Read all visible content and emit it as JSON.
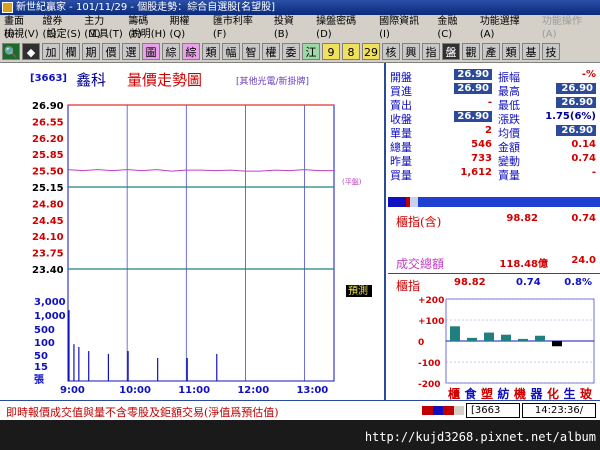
{
  "window": {
    "title": "新世紀贏家 - 101/11/29 - 個股走勢：綜合自選股[名望股]"
  },
  "menu": {
    "row1": [
      "畫面(I)",
      "證券(E)",
      "主力(M)",
      "籌碼(F)",
      "期權(Q)",
      "匯市利率(F)",
      "投資(B)",
      "操盤密碼(D)",
      "國際資訊(I)",
      "金融(C)",
      "功能選擇(A)",
      "功能操作(A)"
    ],
    "row1_disabled": [
      false,
      false,
      false,
      false,
      false,
      false,
      false,
      false,
      false,
      false,
      false,
      true
    ],
    "row2": [
      "檢視(V)",
      "設定(S)",
      "工具(T)",
      "說明(H)"
    ]
  },
  "toolbar": {
    "buttons": [
      {
        "label": "🔍",
        "icon": "search-icon",
        "style": "search"
      },
      {
        "label": "◆",
        "icon": "diamond-icon",
        "style": "dark"
      },
      {
        "label": "加",
        "style": "plain"
      },
      {
        "label": "欄",
        "style": "plain"
      },
      {
        "label": "期",
        "style": "plain"
      },
      {
        "label": "價",
        "style": "plain"
      },
      {
        "label": "選",
        "style": "plain"
      },
      {
        "label": "圖",
        "style": "magenta"
      },
      {
        "label": "綜",
        "style": "plain"
      },
      {
        "label": "綜",
        "style": "magenta"
      },
      {
        "label": "類",
        "style": "plain"
      },
      {
        "label": "幅",
        "style": "plain"
      },
      {
        "label": "智",
        "style": "plain"
      },
      {
        "label": "權",
        "style": "plain"
      },
      {
        "label": "委",
        "style": "plain"
      },
      {
        "label": "江",
        "style": "green"
      },
      {
        "label": "9",
        "style": "yellow"
      },
      {
        "label": "8",
        "style": "yellow"
      },
      {
        "label": "29",
        "style": "yellow"
      },
      {
        "label": "核",
        "style": "plain"
      },
      {
        "label": "興",
        "style": "plain"
      },
      {
        "label": "指",
        "style": "plain"
      },
      {
        "label": "盤",
        "style": "dark"
      },
      {
        "label": "觀",
        "style": "plain"
      },
      {
        "label": "產",
        "style": "plain"
      },
      {
        "label": "類",
        "style": "plain"
      },
      {
        "label": "基",
        "style": "plain"
      },
      {
        "label": "技",
        "style": "plain"
      }
    ]
  },
  "chart_header": {
    "code": "[3663]",
    "name": "鑫科",
    "title": "量價走勢圖",
    "sector": "[其他光電/新掛牌]"
  },
  "chart_data": {
    "type": "line",
    "price_ticks": [
      "26.90",
      "26.55",
      "26.20",
      "25.85",
      "25.50",
      "25.15",
      "24.80",
      "24.45",
      "24.10",
      "23.75",
      "23.40"
    ],
    "ylim": [
      23.4,
      26.9
    ],
    "upper_limit": 26.9,
    "reference": 25.15,
    "lower_limit": 23.4,
    "volume_ticks": [
      "3,000",
      "1,000",
      "500",
      "100",
      "50",
      "15",
      "張"
    ],
    "time_ticks": [
      "9:00",
      "10:00",
      "11:00",
      "12:00",
      "13:00"
    ],
    "ref_marker_label": "(平盤)",
    "price_series": {
      "name": "price",
      "t": [
        0,
        15,
        30,
        45,
        60,
        75,
        90,
        105,
        120,
        135,
        150,
        165,
        180,
        195,
        210,
        225,
        240,
        255,
        270
      ],
      "values": [
        25.52,
        25.5,
        25.52,
        25.5,
        25.52,
        25.5,
        25.52,
        25.49,
        25.51,
        25.51,
        25.5,
        25.51,
        25.49,
        25.49,
        25.51,
        25.5,
        25.52,
        25.5,
        25.5
      ]
    },
    "volume_series": {
      "t": [
        0,
        5,
        10,
        20,
        40,
        60,
        90,
        120,
        150
      ],
      "values": [
        1200,
        40,
        30,
        20,
        15,
        20,
        10,
        10,
        15
      ]
    },
    "estimate_label": "預測"
  },
  "quote": {
    "rows": [
      {
        "l1": "開盤",
        "v1": "26.90",
        "l2": "振幅",
        "v2": "-%",
        "v2_color": "#d00000"
      },
      {
        "l1": "買進",
        "v1": "26.90",
        "l2": "最高",
        "v2": "26.90",
        "v2_box": true
      },
      {
        "l1": "賣出",
        "v1": "-",
        "l2": "最低",
        "v2": "26.90",
        "v2_box": true
      },
      {
        "l1": "收盤",
        "v1": "26.90",
        "l2": "漲跌",
        "v2": "1.75(6%)",
        "v2_color": "#000090"
      },
      {
        "l1": "單量",
        "v1": "2",
        "l2": "均價",
        "v2": "26.90",
        "v2_box": true
      },
      {
        "l1": "總量",
        "v1": "546",
        "l2": "金額",
        "v2": "0.14",
        "v2_color": "#d00000"
      },
      {
        "l1": "昨量",
        "v1": "733",
        "l2": "變動",
        "v2": "0.74",
        "v2_color": "#d00000"
      },
      {
        "l1": "買量",
        "v1": "1,612",
        "l2": "賣量",
        "v2": "-",
        "v2_color": "#d00000"
      }
    ]
  },
  "index_info": {
    "label": "櫃指(含)",
    "value": "98.82",
    "change": "0.74",
    "turnover_label": "成交總額",
    "turnover_value": "118.48億",
    "turnover_change": "24.0",
    "chart_label": "櫃指",
    "chart_value": "98.82",
    "chart_change": "0.74",
    "chart_pct": "0.8%"
  },
  "index_chart": {
    "y_ticks": [
      "+200",
      "+100",
      "0",
      "-100",
      "-200"
    ],
    "bars": [
      70,
      15,
      40,
      30,
      10,
      25,
      -25
    ],
    "categories": [
      "櫃",
      "食",
      "塑",
      "紡",
      "機",
      "器",
      "化",
      "生",
      "玻"
    ]
  },
  "status": {
    "note": "即時報價成交值與量不含零股及鉅額交易(淨值爲預估值)",
    "code": "[3663",
    "time": "14:23:36/",
    "colors": [
      "#c00000",
      "#1010c0",
      "#c00000",
      "#d4d0c8"
    ]
  },
  "taskbar": {
    "watermark": "http://kujd3268.pixnet.net/album"
  },
  "colors": {
    "limit_line": "#e03030",
    "reference_line": "#208080",
    "price_line": "#c040c0",
    "grid": "#1010c0",
    "label_blue": "#1010c0",
    "label_red": "#d00000"
  }
}
